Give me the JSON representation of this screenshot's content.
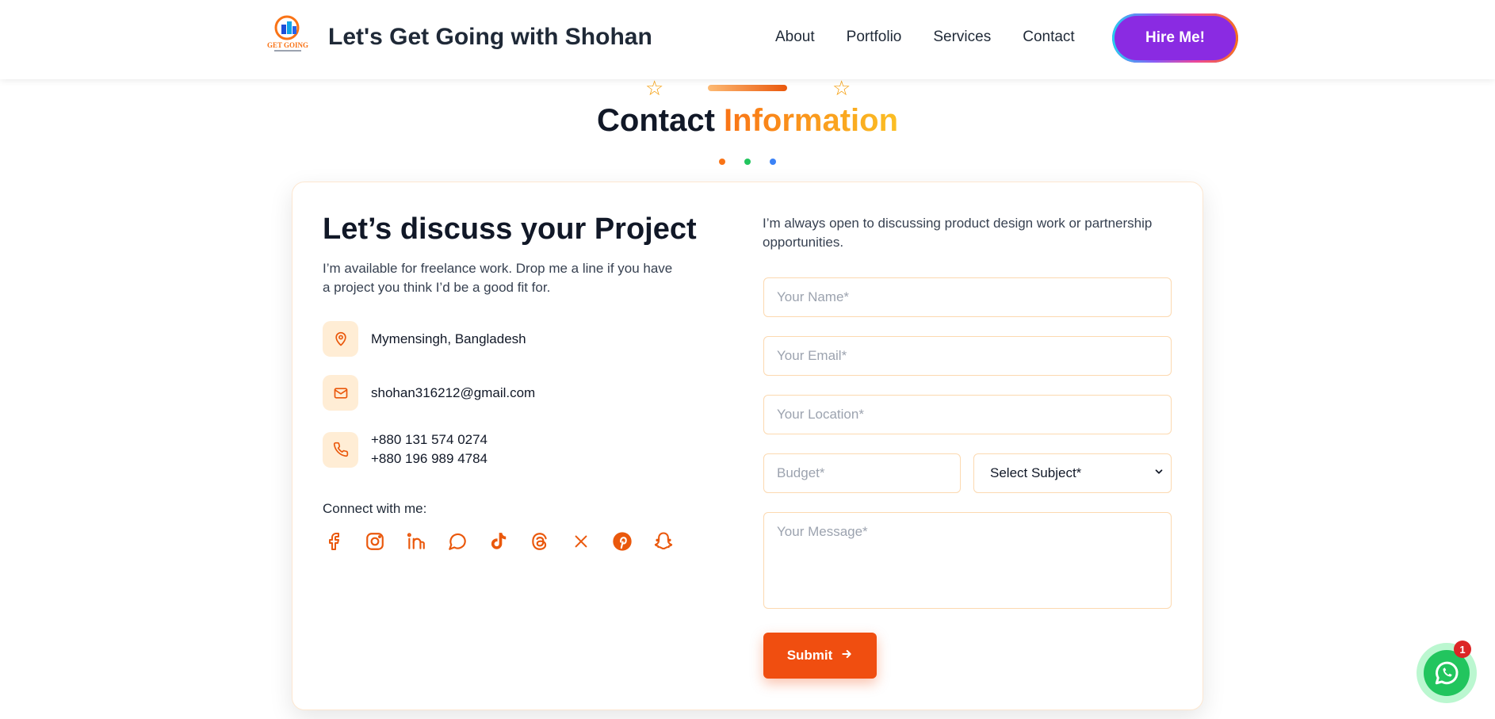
{
  "header": {
    "logo_text": "GET GOING",
    "site_title": "Let's Get Going with Shohan",
    "nav": [
      "About",
      "Portfolio",
      "Services",
      "Contact"
    ],
    "hire_label": "Hire Me!"
  },
  "section": {
    "title_part1": "Contact",
    "title_part2": "Information"
  },
  "left": {
    "title": "Let’s discuss your Project",
    "description": "I’m available for freelance work. Drop me a line if you have a project you think I’d be a good fit for.",
    "location": "Mymensingh, Bangladesh",
    "email": "shohan316212@gmail.com",
    "phone1": "+880 131 574 0274",
    "phone2": "+880 196 989 4784",
    "connect_label": "Connect with me:",
    "socials": [
      "facebook-icon",
      "instagram-icon",
      "linkedin-icon",
      "messenger-icon",
      "tiktok-icon",
      "threads-icon",
      "x-icon",
      "pinterest-icon",
      "snapchat-icon"
    ]
  },
  "form": {
    "intro": "I’m always open to discussing product design work or partnership opportunities.",
    "name_placeholder": "Your Name*",
    "email_placeholder": "Your Email*",
    "location_placeholder": "Your Location*",
    "budget_placeholder": "Budget*",
    "subject_selected": "Select Subject*",
    "message_placeholder": "Your Message*",
    "submit_label": "Submit"
  },
  "whatsapp": {
    "badge_count": "1"
  },
  "colors": {
    "accent": "#f04e10",
    "hire": "#8a2be2",
    "icon_bg": "#ffedd5"
  }
}
